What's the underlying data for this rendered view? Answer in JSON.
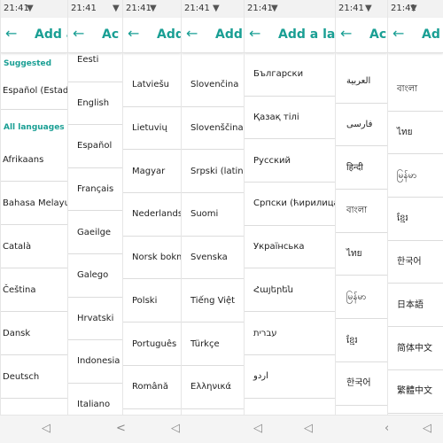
{
  "app": {
    "time": "21:41",
    "accent": "#1a9f94"
  },
  "screens": [
    {
      "title": "Add a",
      "headers": [
        {
          "label": "Suggested",
          "y": 10
        },
        {
          "label": "All languages",
          "y": 82
        }
      ],
      "items": [
        "Español (Estad",
        "Afrikaans",
        "Bahasa Melayu",
        "Català",
        "Čeština",
        "Dansk",
        "Deutsch"
      ]
    },
    {
      "title": "Ac",
      "items": [
        "Eesti",
        "English",
        "Español",
        "Français",
        "Gaeilge",
        "Galego",
        "Hrvatski",
        "Indonesia",
        "Italiano"
      ]
    },
    {
      "title": "Add",
      "items": [
        "Latviešu",
        "Lietuvių",
        "Magyar",
        "Nederlands",
        "Norsk bokm",
        "Polski",
        "Português",
        "Română"
      ]
    },
    {
      "title": "Add",
      "items": [
        "Slovenčina",
        "Slovenščina",
        "Srpski (latini",
        "Suomi",
        "Svenska",
        "Tiếng Việt",
        "Türkçe",
        "Ελληνικά"
      ]
    },
    {
      "title": "Add a lan",
      "items": [
        "Български",
        "Қазақ тілі",
        "Русский",
        "Српски (ћирилица",
        "Українська",
        "Հայերեն",
        "עברית",
        "اردو"
      ]
    },
    {
      "title": "Ac",
      "items": [
        "العربية",
        "فارسی",
        "हिन्दी",
        "বাংলা",
        "ไทย",
        "မြန်မာ",
        "ខ្មែរ",
        "한국어"
      ]
    },
    {
      "title": "Ad",
      "items": [
        "বাংলা",
        "ไทย",
        "မြန်မာ",
        "ខ្មែរ",
        "한국어",
        "日本語",
        "简体中文",
        "繁體中文"
      ]
    }
  ]
}
